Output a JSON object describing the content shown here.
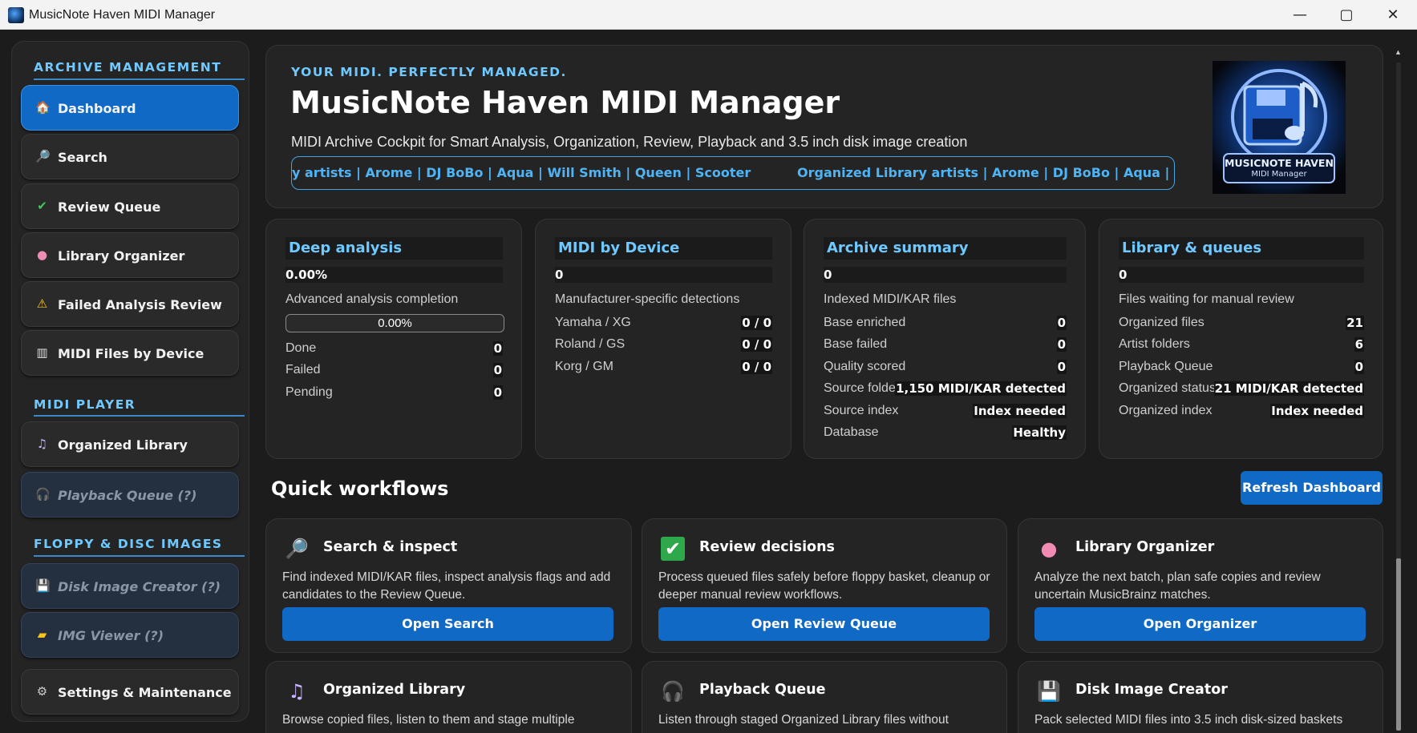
{
  "window": {
    "title": "MusicNote Haven MIDI Manager",
    "minimize_icon": "minimize-icon",
    "maximize_icon": "maximize-icon",
    "close_icon": "close-icon"
  },
  "sidebar": {
    "sections": [
      {
        "title": "ARCHIVE MANAGEMENT"
      },
      {
        "title": "MIDI PLAYER"
      },
      {
        "title": "FLOPPY & DISC IMAGES"
      }
    ],
    "items": [
      {
        "label": "Dashboard",
        "icon": "house-icon",
        "glyph": "🏠"
      },
      {
        "label": "Search",
        "icon": "magnifier-icon",
        "glyph": "🔎"
      },
      {
        "label": "Review Queue",
        "icon": "checkmark-icon",
        "glyph": "✔"
      },
      {
        "label": "Library Organizer",
        "icon": "brain-icon",
        "glyph": "●"
      },
      {
        "label": "Failed Analysis Review",
        "icon": "warning-icon",
        "glyph": "⚠"
      },
      {
        "label": "MIDI Files by Device",
        "icon": "piano-icon",
        "glyph": "▥"
      },
      {
        "label": "Organized Library",
        "icon": "music-library-icon",
        "glyph": "♫"
      },
      {
        "label": "Playback Queue  (?)",
        "icon": "headphones-icon",
        "glyph": "🎧"
      },
      {
        "label": "Disk Image Creator  (?)",
        "icon": "floppy-icon",
        "glyph": "💾"
      },
      {
        "label": "IMG Viewer  (?)",
        "icon": "folder-icon",
        "glyph": "▰"
      },
      {
        "label": "Settings & Maintenance",
        "icon": "gear-icon",
        "glyph": "⚙"
      }
    ]
  },
  "hero": {
    "tagline": "YOUR MIDI. PERFECTLY MANAGED.",
    "title": "MusicNote Haven MIDI Manager",
    "subtitle": "MIDI Archive Cockpit for Smart Analysis, Organization, Review, Playback and 3.5 inch disk image creation",
    "ticker_a": "y artists  |  Arome  |  DJ BoBo  |  Aqua  |  Will Smith  |  Queen  |  Scooter",
    "ticker_b": "Organized Library artists  |  Arome  |  DJ BoBo  |  Aqua  |  W",
    "logo_line1": "MUSICNOTE HAVEN",
    "logo_line2": "MIDI Manager"
  },
  "cards": {
    "deep": {
      "title": "Deep analysis",
      "value": "0.00%",
      "desc": "Advanced analysis completion",
      "progress_text": "0.00%",
      "progress_fraction": 0.0,
      "rows": [
        {
          "label": "Done",
          "value": "0"
        },
        {
          "label": "Failed",
          "value": "0"
        },
        {
          "label": "Pending",
          "value": "0"
        }
      ]
    },
    "device": {
      "title": "MIDI by Device",
      "value": "0",
      "desc": "Manufacturer-specific detections",
      "rows": [
        {
          "label": "Yamaha / XG",
          "value": "0 / 0"
        },
        {
          "label": "Roland / GS",
          "value": "0 / 0"
        },
        {
          "label": "Korg / GM",
          "value": "0 / 0"
        }
      ]
    },
    "archive": {
      "title": "Archive summary",
      "value": "0",
      "desc": "Indexed MIDI/KAR files",
      "rows": [
        {
          "label": "Base enriched",
          "value": "0"
        },
        {
          "label": "Base failed",
          "value": "0"
        },
        {
          "label": "Quality scored",
          "value": "0"
        },
        {
          "label": "Source folder",
          "value": "1,150 MIDI/KAR detected"
        },
        {
          "label": "Source index",
          "value": "Index needed"
        },
        {
          "label": "Database",
          "value": "Healthy"
        }
      ]
    },
    "library": {
      "title": "Library & queues",
      "value": "0",
      "desc": "Files waiting for manual review",
      "rows": [
        {
          "label": "Organized files",
          "value": "21"
        },
        {
          "label": "Artist folders",
          "value": "6"
        },
        {
          "label": "Playback Queue",
          "value": "0"
        },
        {
          "label": "Organized status",
          "value": "21 MIDI/KAR detected"
        },
        {
          "label": "Organized index",
          "value": "Index needed"
        }
      ]
    }
  },
  "workflows": {
    "title": "Quick workflows",
    "refresh_label": "Refresh Dashboard",
    "items": [
      {
        "title": "Search & inspect",
        "icon": "magnifier-icon",
        "glyph": "🔎",
        "desc": "Find indexed MIDI/KAR files, inspect analysis flags and add candidates to the Review Queue.",
        "button": "Open Search"
      },
      {
        "title": "Review decisions",
        "icon": "checkmark-icon",
        "glyph": "✔",
        "desc": "Process queued files safely before floppy basket, cleanup or deeper manual review workflows.",
        "button": "Open Review Queue"
      },
      {
        "title": "Library Organizer",
        "icon": "brain-icon",
        "glyph": "●",
        "desc": "Analyze the next batch, plan safe copies and review uncertain MusicBrainz matches.",
        "button": "Open Organizer"
      },
      {
        "title": "Organized Library",
        "icon": "music-library-icon",
        "glyph": "♫",
        "desc": "Browse copied files, listen to them and stage multiple",
        "button": ""
      },
      {
        "title": "Playback Queue",
        "icon": "headphones-icon",
        "glyph": "🎧",
        "desc": "Listen through staged Organized Library files without",
        "button": ""
      },
      {
        "title": "Disk Image Creator",
        "icon": "floppy-icon",
        "glyph": "💾",
        "desc": "Pack selected MIDI files into 3.5 inch disk-sized baskets",
        "button": ""
      }
    ]
  },
  "colors": {
    "accent": "#1069c4",
    "heading": "#6fc9ff",
    "background": "#1c1c1c",
    "panel": "#242424"
  }
}
